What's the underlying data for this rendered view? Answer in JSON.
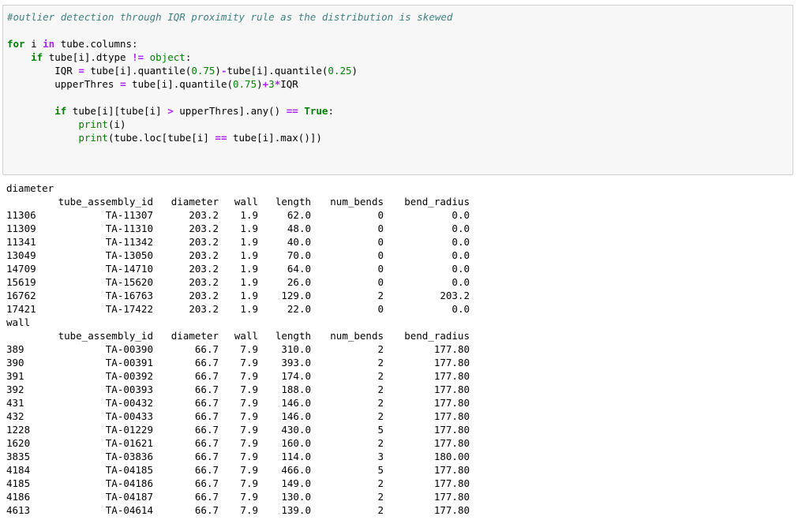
{
  "code_lines": [
    [
      {
        "t": "#outlier detection through IQR proximity rule as the distribution is skewed",
        "c": "cm"
      }
    ],
    [
      {
        "t": "",
        "c": ""
      }
    ],
    [
      {
        "t": "for",
        "c": "kw"
      },
      {
        "t": " i ",
        "c": ""
      },
      {
        "t": "in",
        "c": "op"
      },
      {
        "t": " tube.columns:",
        "c": ""
      }
    ],
    [
      {
        "t": "    ",
        "c": ""
      },
      {
        "t": "if",
        "c": "kw"
      },
      {
        "t": " tube[i].dtype ",
        "c": ""
      },
      {
        "t": "!=",
        "c": "op"
      },
      {
        "t": " ",
        "c": ""
      },
      {
        "t": "object",
        "c": "nb"
      },
      {
        "t": ":",
        "c": ""
      }
    ],
    [
      {
        "t": "        IQR ",
        "c": ""
      },
      {
        "t": "=",
        "c": "op"
      },
      {
        "t": " tube[i].quantile(",
        "c": ""
      },
      {
        "t": "0.75",
        "c": "num"
      },
      {
        "t": ")",
        "c": ""
      },
      {
        "t": "-",
        "c": "op"
      },
      {
        "t": "tube[i].quantile(",
        "c": ""
      },
      {
        "t": "0.25",
        "c": "num"
      },
      {
        "t": ")",
        "c": ""
      }
    ],
    [
      {
        "t": "        upperThres ",
        "c": ""
      },
      {
        "t": "=",
        "c": "op"
      },
      {
        "t": " tube[i].quantile(",
        "c": ""
      },
      {
        "t": "0.75",
        "c": "num"
      },
      {
        "t": ")",
        "c": ""
      },
      {
        "t": "+",
        "c": "op"
      },
      {
        "t": "3",
        "c": "num"
      },
      {
        "t": "*",
        "c": "op"
      },
      {
        "t": "IQR",
        "c": ""
      }
    ],
    [
      {
        "t": "",
        "c": ""
      }
    ],
    [
      {
        "t": "        ",
        "c": ""
      },
      {
        "t": "if",
        "c": "kw"
      },
      {
        "t": " tube[i][tube[i] ",
        "c": ""
      },
      {
        "t": ">",
        "c": "op"
      },
      {
        "t": " upperThres].any() ",
        "c": ""
      },
      {
        "t": "==",
        "c": "op"
      },
      {
        "t": " ",
        "c": ""
      },
      {
        "t": "True",
        "c": "kw"
      },
      {
        "t": ":",
        "c": ""
      }
    ],
    [
      {
        "t": "            ",
        "c": ""
      },
      {
        "t": "print",
        "c": "nb"
      },
      {
        "t": "(i)",
        "c": ""
      }
    ],
    [
      {
        "t": "            ",
        "c": ""
      },
      {
        "t": "print",
        "c": "nb"
      },
      {
        "t": "(tube.loc[tube[i] ",
        "c": ""
      },
      {
        "t": "==",
        "c": "op"
      },
      {
        "t": " tube[i].max()])",
        "c": ""
      }
    ]
  ],
  "output_blocks": [
    {
      "name": "diameter",
      "headers": [
        "",
        "tube_assembly_id",
        "diameter",
        "wall",
        "length",
        "num_bends",
        "bend_radius"
      ],
      "rows": [
        [
          "11306",
          "TA-11307",
          "203.2",
          "1.9",
          "62.0",
          "0",
          "0.0"
        ],
        [
          "11309",
          "TA-11310",
          "203.2",
          "1.9",
          "48.0",
          "0",
          "0.0"
        ],
        [
          "11341",
          "TA-11342",
          "203.2",
          "1.9",
          "40.0",
          "0",
          "0.0"
        ],
        [
          "13049",
          "TA-13050",
          "203.2",
          "1.9",
          "70.0",
          "0",
          "0.0"
        ],
        [
          "14709",
          "TA-14710",
          "203.2",
          "1.9",
          "64.0",
          "0",
          "0.0"
        ],
        [
          "15619",
          "TA-15620",
          "203.2",
          "1.9",
          "26.0",
          "0",
          "0.0"
        ],
        [
          "16762",
          "TA-16763",
          "203.2",
          "1.9",
          "129.0",
          "2",
          "203.2"
        ],
        [
          "17421",
          "TA-17422",
          "203.2",
          "1.9",
          "22.0",
          "0",
          "0.0"
        ]
      ]
    },
    {
      "name": "wall",
      "headers": [
        "",
        "tube_assembly_id",
        "diameter",
        "wall",
        "length",
        "num_bends",
        "bend_radius"
      ],
      "rows": [
        [
          "389",
          "TA-00390",
          "66.7",
          "7.9",
          "310.0",
          "2",
          "177.80"
        ],
        [
          "390",
          "TA-00391",
          "66.7",
          "7.9",
          "393.0",
          "2",
          "177.80"
        ],
        [
          "391",
          "TA-00392",
          "66.7",
          "7.9",
          "174.0",
          "2",
          "177.80"
        ],
        [
          "392",
          "TA-00393",
          "66.7",
          "7.9",
          "188.0",
          "2",
          "177.80"
        ],
        [
          "431",
          "TA-00432",
          "66.7",
          "7.9",
          "146.0",
          "2",
          "177.80"
        ],
        [
          "432",
          "TA-00433",
          "66.7",
          "7.9",
          "146.0",
          "2",
          "177.80"
        ],
        [
          "1228",
          "TA-01229",
          "66.7",
          "7.9",
          "430.0",
          "5",
          "177.80"
        ],
        [
          "1620",
          "TA-01621",
          "66.7",
          "7.9",
          "160.0",
          "2",
          "177.80"
        ],
        [
          "3835",
          "TA-03836",
          "66.7",
          "7.9",
          "114.0",
          "3",
          "180.00"
        ],
        [
          "4184",
          "TA-04185",
          "66.7",
          "7.9",
          "466.0",
          "5",
          "177.80"
        ],
        [
          "4185",
          "TA-04186",
          "66.7",
          "7.9",
          "149.0",
          "2",
          "177.80"
        ],
        [
          "4186",
          "TA-04187",
          "66.7",
          "7.9",
          "130.0",
          "2",
          "177.80"
        ],
        [
          "4613",
          "TA-04614",
          "66.7",
          "7.9",
          "139.0",
          "2",
          "177.80"
        ]
      ]
    }
  ],
  "colors": {
    "comment": "#408080",
    "keyword": "#008000",
    "operator": "#aa22ff",
    "number": "#008000",
    "cell_bg": "#f7f7f7",
    "cell_border": "#cfcfcf"
  }
}
